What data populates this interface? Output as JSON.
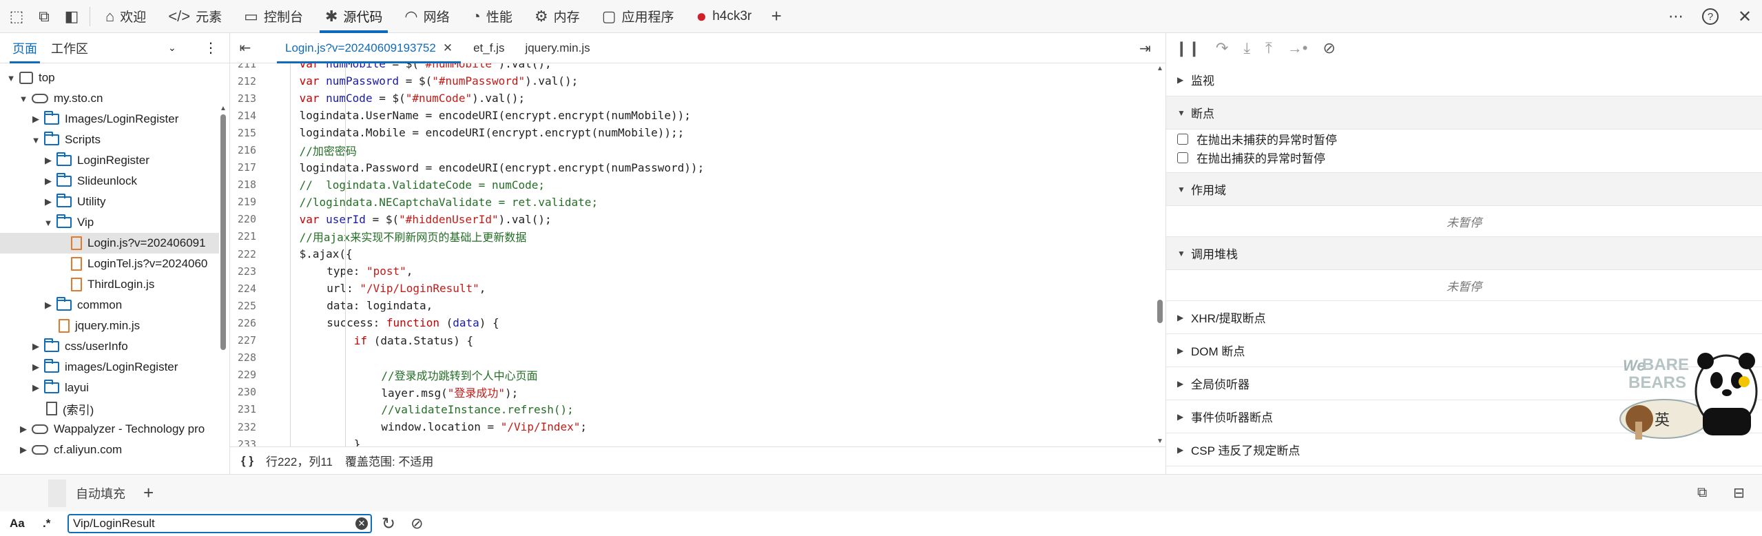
{
  "toolbar": {
    "tabs": [
      {
        "label": "欢迎",
        "icon": "home-icon"
      },
      {
        "label": "元素",
        "icon": "code-icon"
      },
      {
        "label": "控制台",
        "icon": "console-icon"
      },
      {
        "label": "源代码",
        "icon": "bug-icon"
      },
      {
        "label": "网络",
        "icon": "wifi-icon"
      },
      {
        "label": "性能",
        "icon": "gauge-icon"
      },
      {
        "label": "内存",
        "icon": "chip-icon"
      },
      {
        "label": "应用程序",
        "icon": "app-icon"
      },
      {
        "label": "h4ck3r",
        "icon": "among-us-icon"
      }
    ],
    "active_tab": "源代码"
  },
  "left": {
    "tabs": [
      "页面",
      "工作区"
    ],
    "tree": [
      {
        "label": "top",
        "depth": 0,
        "arrow": "▼",
        "icon": "frame"
      },
      {
        "label": "my.sto.cn",
        "depth": 1,
        "arrow": "▼",
        "icon": "cloud"
      },
      {
        "label": "Images/LoginRegister",
        "depth": 2,
        "arrow": "▶",
        "icon": "folder"
      },
      {
        "label": "Scripts",
        "depth": 2,
        "arrow": "▼",
        "icon": "folder"
      },
      {
        "label": "LoginRegister",
        "depth": 3,
        "arrow": "▶",
        "icon": "folder"
      },
      {
        "label": "Slideunlock",
        "depth": 3,
        "arrow": "▶",
        "icon": "folder"
      },
      {
        "label": "Utility",
        "depth": 3,
        "arrow": "▶",
        "icon": "folder"
      },
      {
        "label": "Vip",
        "depth": 3,
        "arrow": "▼",
        "icon": "folder"
      },
      {
        "label": "Login.js?v=202406091",
        "depth": 4,
        "arrow": "",
        "icon": "file",
        "selected": true
      },
      {
        "label": "LoginTel.js?v=2024060",
        "depth": 4,
        "arrow": "",
        "icon": "file"
      },
      {
        "label": "ThirdLogin.js",
        "depth": 4,
        "arrow": "",
        "icon": "file"
      },
      {
        "label": "common",
        "depth": 3,
        "arrow": "▶",
        "icon": "folder"
      },
      {
        "label": "jquery.min.js",
        "depth": 3,
        "arrow": "",
        "icon": "file"
      },
      {
        "label": "css/userInfo",
        "depth": 2,
        "arrow": "▶",
        "icon": "folder"
      },
      {
        "label": "images/LoginRegister",
        "depth": 2,
        "arrow": "▶",
        "icon": "folder"
      },
      {
        "label": "layui",
        "depth": 2,
        "arrow": "▶",
        "icon": "folder"
      },
      {
        "label": "(索引)",
        "depth": 2,
        "arrow": "",
        "icon": "filegray"
      },
      {
        "label": "Wappalyzer - Technology pro",
        "depth": 1,
        "arrow": "▶",
        "icon": "cloud"
      },
      {
        "label": "cf.aliyun.com",
        "depth": 1,
        "arrow": "▶",
        "icon": "cloud"
      }
    ]
  },
  "editor": {
    "tabs": [
      {
        "label": "Login.js?v=20240609193752",
        "closable": true,
        "active": true
      },
      {
        "label": "et_f.js",
        "closable": false,
        "active": false
      },
      {
        "label": "jquery.min.js",
        "closable": false,
        "active": false
      }
    ],
    "lines": [
      {
        "n": "211",
        "indent": 4,
        "html": "<span class='kw'>var</span> <span class='vr'>numMobile</span> = $(<span class='str'>\"#numMobile\"</span>).val();"
      },
      {
        "n": "212",
        "indent": 4,
        "html": "<span class='kw'>var</span> <span class='vr'>numPassword</span> = $(<span class='str'>\"#numPassword\"</span>).val();"
      },
      {
        "n": "213",
        "indent": 4,
        "html": "<span class='kw'>var</span> <span class='vr'>numCode</span> = $(<span class='str'>\"#numCode\"</span>).val();"
      },
      {
        "n": "214",
        "indent": 4,
        "html": "logindata.UserName = encodeURI(encrypt.encrypt(numMobile));"
      },
      {
        "n": "215",
        "indent": 4,
        "html": "logindata.Mobile = encodeURI(encrypt.encrypt(numMobile));;"
      },
      {
        "n": "216",
        "indent": 4,
        "html": "<span class='cm'>//加密密码</span>"
      },
      {
        "n": "217",
        "indent": 4,
        "html": "logindata.Password = encodeURI(encrypt.encrypt(numPassword));"
      },
      {
        "n": "218",
        "indent": 4,
        "html": "<span class='cm'>//  logindata.ValidateCode = numCode;</span>"
      },
      {
        "n": "219",
        "indent": 4,
        "html": "<span class='cm'>//logindata.NECaptchaValidate = ret.validate;</span>"
      },
      {
        "n": "220",
        "indent": 4,
        "html": "<span class='kw'>var</span> <span class='vr'>userId</span> = $(<span class='str'>\"#hiddenUserId\"</span>).val();"
      },
      {
        "n": "221",
        "indent": 4,
        "html": "<span class='cm'>//用ajax来实现不刷新网页的基础上更新数据</span>"
      },
      {
        "n": "222",
        "indent": 4,
        "html": "$.ajax({"
      },
      {
        "n": "223",
        "indent": 8,
        "html": "type: <span class='str'>\"post\"</span>,"
      },
      {
        "n": "224",
        "indent": 8,
        "html": "url: <span class='str'>\"/Vip/LoginResult\"</span>,"
      },
      {
        "n": "225",
        "indent": 8,
        "html": "data: logindata,"
      },
      {
        "n": "226",
        "indent": 8,
        "html": "success: <span class='kw'>function</span> (<span class='vr'>data</span>) {"
      },
      {
        "n": "227",
        "indent": 12,
        "html": "<span class='kw'>if</span> (data.Status) {"
      },
      {
        "n": "228",
        "indent": 0,
        "html": ""
      },
      {
        "n": "229",
        "indent": 16,
        "html": "<span class='cm'>//登录成功跳转到个人中心页面</span>"
      },
      {
        "n": "230",
        "indent": 16,
        "html": "layer.msg(<span class='str'>\"登录成功\"</span>);"
      },
      {
        "n": "231",
        "indent": 16,
        "html": "<span class='cm'>//validateInstance.refresh();</span>"
      },
      {
        "n": "232",
        "indent": 16,
        "html": "window.location = <span class='str'>\"/Vip/Index\"</span>;"
      },
      {
        "n": "233",
        "indent": 12,
        "html": "}"
      }
    ],
    "status": {
      "braces": "{ }",
      "position": "行222，列11",
      "coverage": "覆盖范围: 不适用"
    }
  },
  "right": {
    "sections": [
      {
        "label": "监视",
        "open": false
      },
      {
        "label": "断点",
        "open": true,
        "checkboxes": [
          "在抛出未捕获的异常时暂停",
          "在抛出捕获的异常时暂停"
        ]
      },
      {
        "label": "作用域",
        "open": true,
        "paused": "未暂停"
      },
      {
        "label": "调用堆栈",
        "open": true,
        "paused": "未暂停"
      },
      {
        "label": "XHR/提取断点",
        "open": false
      },
      {
        "label": "DOM 断点",
        "open": false
      },
      {
        "label": "全局侦听器",
        "open": false
      },
      {
        "label": "事件侦听器断点",
        "open": false
      },
      {
        "label": "CSP 违反了规定断点",
        "open": false
      }
    ],
    "sticker": {
      "line1": "We",
      "line2": "BARE",
      "line3": "BEARS",
      "badge": "英"
    }
  },
  "drawer": {
    "tab_label": "自动填充"
  },
  "search": {
    "case_label": "Aa",
    "regex_label": ".*",
    "query": "Vip/LoginResult"
  },
  "colors": {
    "accent": "#0f6cbd",
    "keyword": "#c80000",
    "string": "#c41a16",
    "comment": "#236e25"
  }
}
